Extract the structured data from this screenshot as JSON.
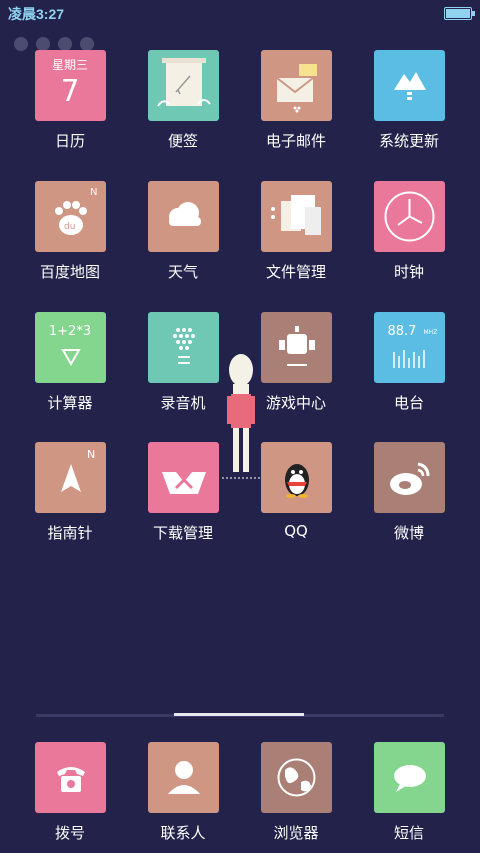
{
  "status_bar": {
    "time": "凌晨3:27"
  },
  "apps": [
    {
      "id": "calendar",
      "label": "日历",
      "color": "#e9789a",
      "cal_head": "星期三",
      "cal_day": "7"
    },
    {
      "id": "notes",
      "label": "便签",
      "color": "#6fc8b4"
    },
    {
      "id": "email",
      "label": "电子邮件",
      "color": "#cf9683"
    },
    {
      "id": "system-update",
      "label": "系统更新",
      "color": "#5bbde3"
    },
    {
      "id": "baidu-map",
      "label": "百度地图",
      "color": "#cf9683"
    },
    {
      "id": "weather",
      "label": "天气",
      "color": "#cf9683"
    },
    {
      "id": "file-manager",
      "label": "文件管理",
      "color": "#cf9683"
    },
    {
      "id": "clock",
      "label": "时钟",
      "color": "#e9789a"
    },
    {
      "id": "calculator",
      "label": "计算器",
      "color": "#84d68f",
      "calc_text": "1+2*3"
    },
    {
      "id": "recorder",
      "label": "录音机",
      "color": "#6fc8b4"
    },
    {
      "id": "game-center",
      "label": "游戏中心",
      "color": "#a97f76"
    },
    {
      "id": "radio",
      "label": "电台",
      "color": "#5bbde3",
      "radio_freq": "88.7",
      "radio_unit": "MHZ"
    },
    {
      "id": "compass",
      "label": "指南针",
      "color": "#cf9683"
    },
    {
      "id": "download-manager",
      "label": "下载管理",
      "color": "#e9789a"
    },
    {
      "id": "qq",
      "label": "QQ",
      "color": "#cf9683"
    },
    {
      "id": "weibo",
      "label": "微博",
      "color": "#a97f76"
    }
  ],
  "dock": [
    {
      "id": "dialer",
      "label": "拨号",
      "color": "#e9789a"
    },
    {
      "id": "contacts",
      "label": "联系人",
      "color": "#cf9683"
    },
    {
      "id": "browser",
      "label": "浏览器",
      "color": "#a97f76"
    },
    {
      "id": "sms",
      "label": "短信",
      "color": "#84d68f"
    }
  ]
}
